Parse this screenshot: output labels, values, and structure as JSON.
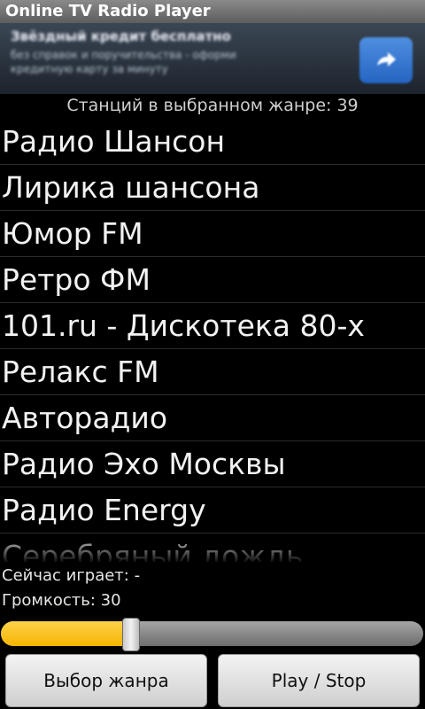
{
  "app": {
    "title": "Online TV Radio Player"
  },
  "ad": {
    "title": "Звёздный кредит бесплатно",
    "line1": "без справок и поручительства - оформи",
    "line2": "кредитную карту за минуту",
    "arrow_icon": "arrow-right-icon"
  },
  "station_count_text": "Станций в выбранном жанре: 39",
  "stations": [
    "Радио Шансон",
    "Лирика шансона",
    "Юмор FM",
    "Ретро ФМ",
    "101.ru - Дискотека 80-х",
    "Релакс FM",
    "Авторадио",
    "Радио Эхо Москвы",
    "Радио Energy",
    "Серебряный дождь"
  ],
  "now_playing_text": "Сейчас играет: -",
  "volume_text": "Громкость: 30",
  "volume": {
    "value": 30,
    "max": 100,
    "fill_color": "#f5b400"
  },
  "buttons": {
    "genre": "Выбор жанра",
    "play_stop": "Play / Stop"
  }
}
